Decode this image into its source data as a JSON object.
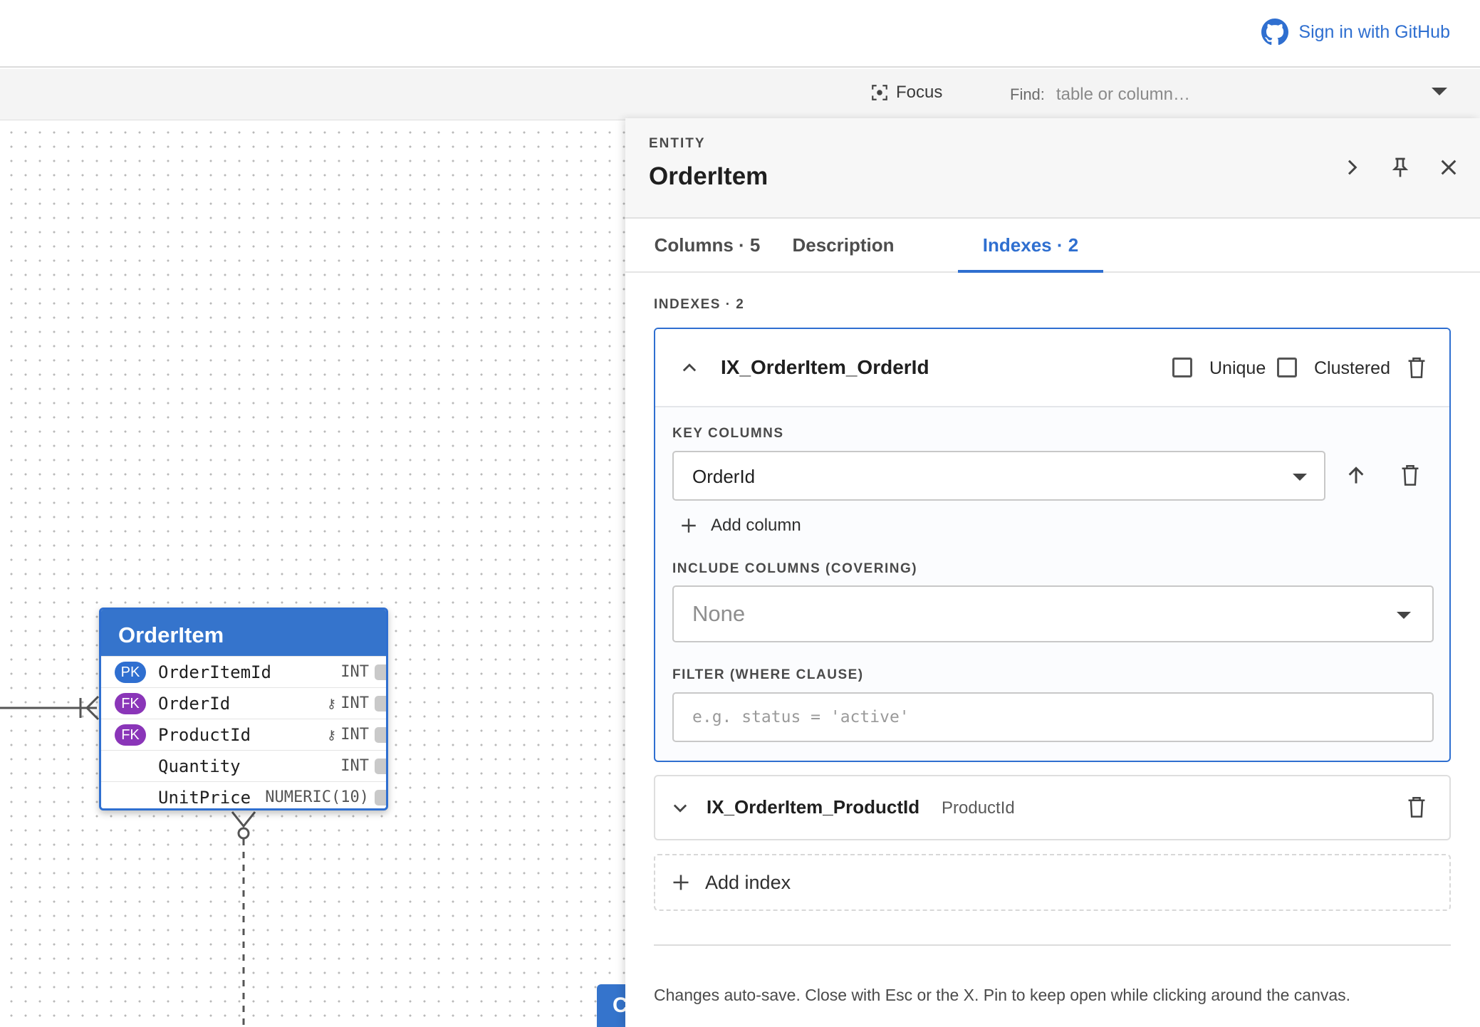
{
  "header": {
    "signin_label": "Sign in with GitHub",
    "signin_icon": "github-icon"
  },
  "toolbar": {
    "focus_label": "Focus",
    "focus_icon": "focus-icon",
    "find_label": "Find:",
    "find_placeholder": "table or column…"
  },
  "canvas": {
    "entity": {
      "name": "OrderItem",
      "columns": [
        {
          "badge": "PK",
          "name": "OrderItemId",
          "type": "INT",
          "key_icon": ""
        },
        {
          "badge": "FK",
          "name": "OrderId",
          "type": "INT",
          "key_icon": "⚷"
        },
        {
          "badge": "FK",
          "name": "ProductId",
          "type": "INT",
          "key_icon": "⚷"
        },
        {
          "badge": "",
          "name": "Quantity",
          "type": "INT",
          "key_icon": ""
        },
        {
          "badge": "",
          "name": "UnitPrice",
          "type": "NUMERIC(10)",
          "key_icon": ""
        }
      ]
    },
    "peek_entity_initial": "C"
  },
  "panel": {
    "eyebrow": "ENTITY",
    "title": "OrderItem",
    "tabs": [
      {
        "label": "Columns · 5",
        "active": false
      },
      {
        "label": "Description",
        "active": false
      },
      {
        "label": "Indexes · 2",
        "active": true
      }
    ],
    "indexes_heading": "INDEXES · 2",
    "indexes": [
      {
        "name": "IX_OrderItem_OrderId",
        "expanded": true,
        "unique_label": "Unique",
        "unique": false,
        "clustered_label": "Clustered",
        "clustered": false,
        "key_columns_label": "KEY COLUMNS",
        "key_columns": [
          "OrderId"
        ],
        "add_column_label": "Add column",
        "include_label": "INCLUDE COLUMNS (COVERING)",
        "include_value": "None",
        "filter_label": "FILTER (WHERE CLAUSE)",
        "filter_placeholder": "e.g. status = 'active'"
      },
      {
        "name": "IX_OrderItem_ProductId",
        "expanded": false,
        "columns_summary": "ProductId"
      }
    ],
    "add_index_label": "Add index",
    "footer_note": "Changes auto-save. Close with Esc or the X. Pin to keep open while clicking around the canvas."
  },
  "colors": {
    "accent": "#2f6fd0",
    "pk_badge": "#2f6fd0",
    "fk_badge": "#8a35b8",
    "entity_header": "#3574cc"
  }
}
